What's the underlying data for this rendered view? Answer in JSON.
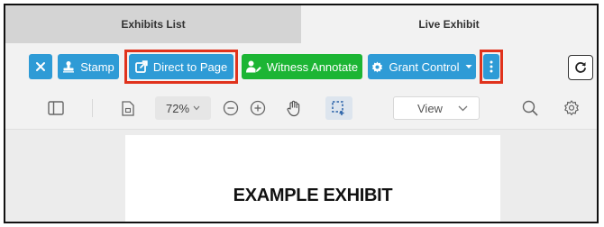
{
  "tabs": [
    {
      "label": "Exhibits List",
      "active": false
    },
    {
      "label": "Live Exhibit",
      "active": true
    }
  ],
  "toolbar": {
    "close_icon": "close-icon",
    "stamp_label": "Stamp",
    "direct_to_page_label": "Direct to Page",
    "witness_annotate_label": "Witness Annotate",
    "grant_control_label": "Grant Control",
    "more_icon": "vertical-ellipsis-icon",
    "refresh_icon": "refresh-icon"
  },
  "viewer": {
    "zoom": "72%",
    "view_select": "View"
  },
  "document": {
    "title": "EXAMPLE EXHIBIT"
  },
  "colors": {
    "primary_blue": "#2e9bd6",
    "success_green": "#1cb534",
    "highlight_red": "#e0321c"
  }
}
